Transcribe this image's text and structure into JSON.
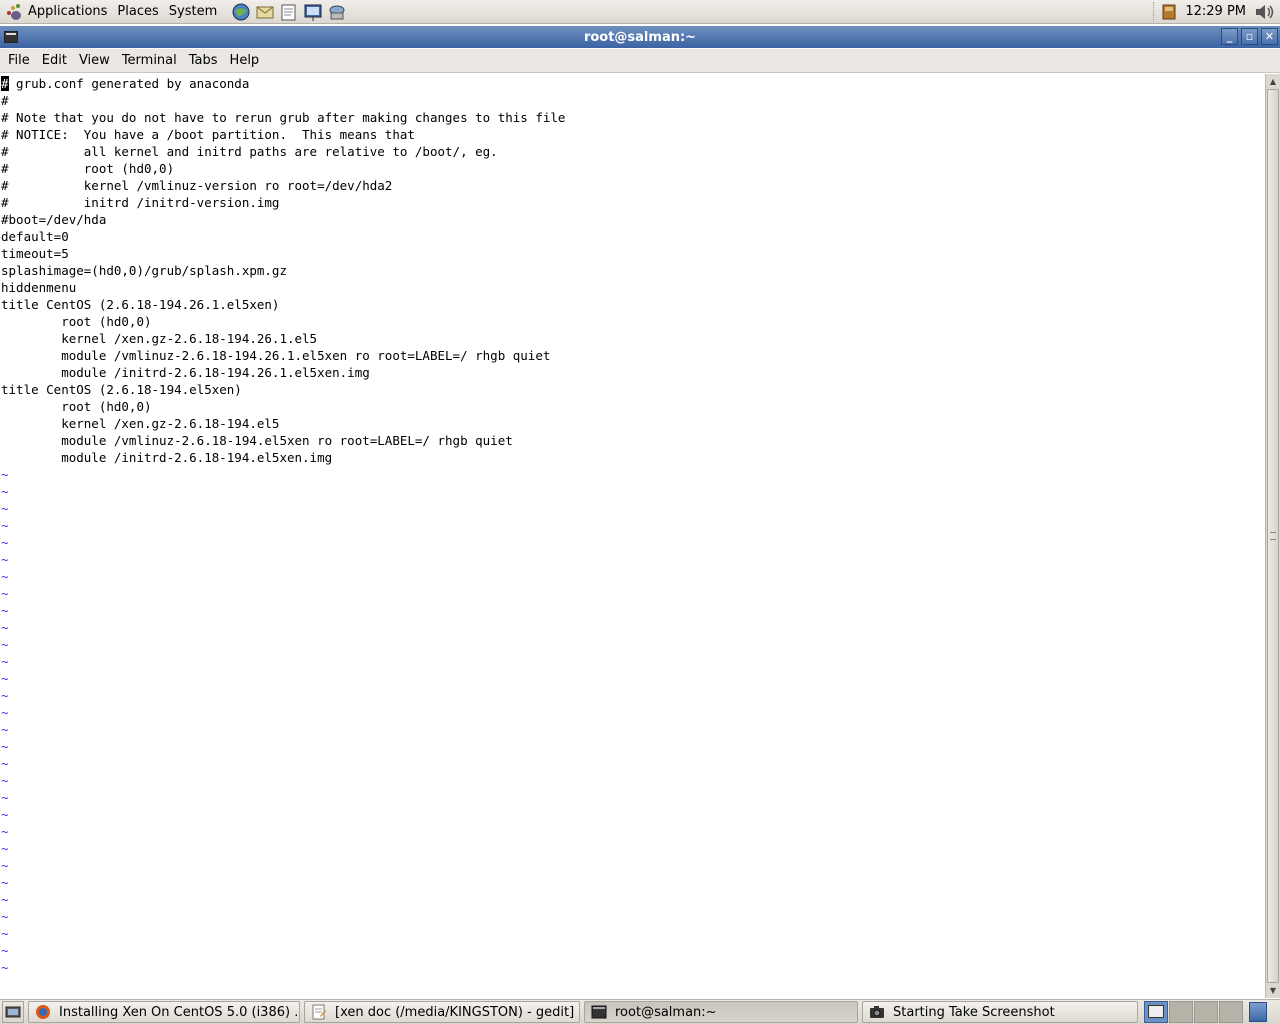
{
  "top_panel": {
    "menus": [
      "Applications",
      "Places",
      "System"
    ],
    "launchers": [
      "web-browser-icon",
      "email-client-icon",
      "text-editor-icon",
      "presentation-icon",
      "network-icon"
    ],
    "clock": "12:29 PM",
    "tray_icons": [
      "notes-icon",
      "volume-icon"
    ]
  },
  "window": {
    "title": "root@salman:~",
    "menu": [
      "File",
      "Edit",
      "View",
      "Terminal",
      "Tabs",
      "Help"
    ]
  },
  "terminal": {
    "cursor_char": "#",
    "lines": [
      " grub.conf generated by anaconda",
      "#",
      "# Note that you do not have to rerun grub after making changes to this file",
      "# NOTICE:  You have a /boot partition.  This means that",
      "#          all kernel and initrd paths are relative to /boot/, eg.",
      "#          root (hd0,0)",
      "#          kernel /vmlinuz-version ro root=/dev/hda2",
      "#          initrd /initrd-version.img",
      "#boot=/dev/hda",
      "default=0",
      "timeout=5",
      "splashimage=(hd0,0)/grub/splash.xpm.gz",
      "hiddenmenu",
      "title CentOS (2.6.18-194.26.1.el5xen)",
      "        root (hd0,0)",
      "        kernel /xen.gz-2.6.18-194.26.1.el5",
      "        module /vmlinuz-2.6.18-194.26.1.el5xen ro root=LABEL=/ rhgb quiet",
      "        module /initrd-2.6.18-194.26.1.el5xen.img",
      "title CentOS (2.6.18-194.el5xen)",
      "        root (hd0,0)",
      "        kernel /xen.gz-2.6.18-194.el5",
      "        module /vmlinuz-2.6.18-194.el5xen ro root=LABEL=/ rhgb quiet",
      "        module /initrd-2.6.18-194.el5xen.img"
    ],
    "tilde": "~",
    "tilde_count": 30
  },
  "taskbar": {
    "tasks": [
      {
        "label": "Installing Xen On CentOS 5.0 (i386) ...",
        "icon": "firefox-icon",
        "active": false
      },
      {
        "label": "[xen doc (/media/KINGSTON) - gedit]",
        "icon": "gedit-icon",
        "active": false
      },
      {
        "label": "root@salman:~",
        "icon": "terminal-icon",
        "active": true
      },
      {
        "label": "Starting Take Screenshot",
        "icon": "camera-icon",
        "active": false
      }
    ],
    "workspaces": 4,
    "current_workspace": 1
  }
}
